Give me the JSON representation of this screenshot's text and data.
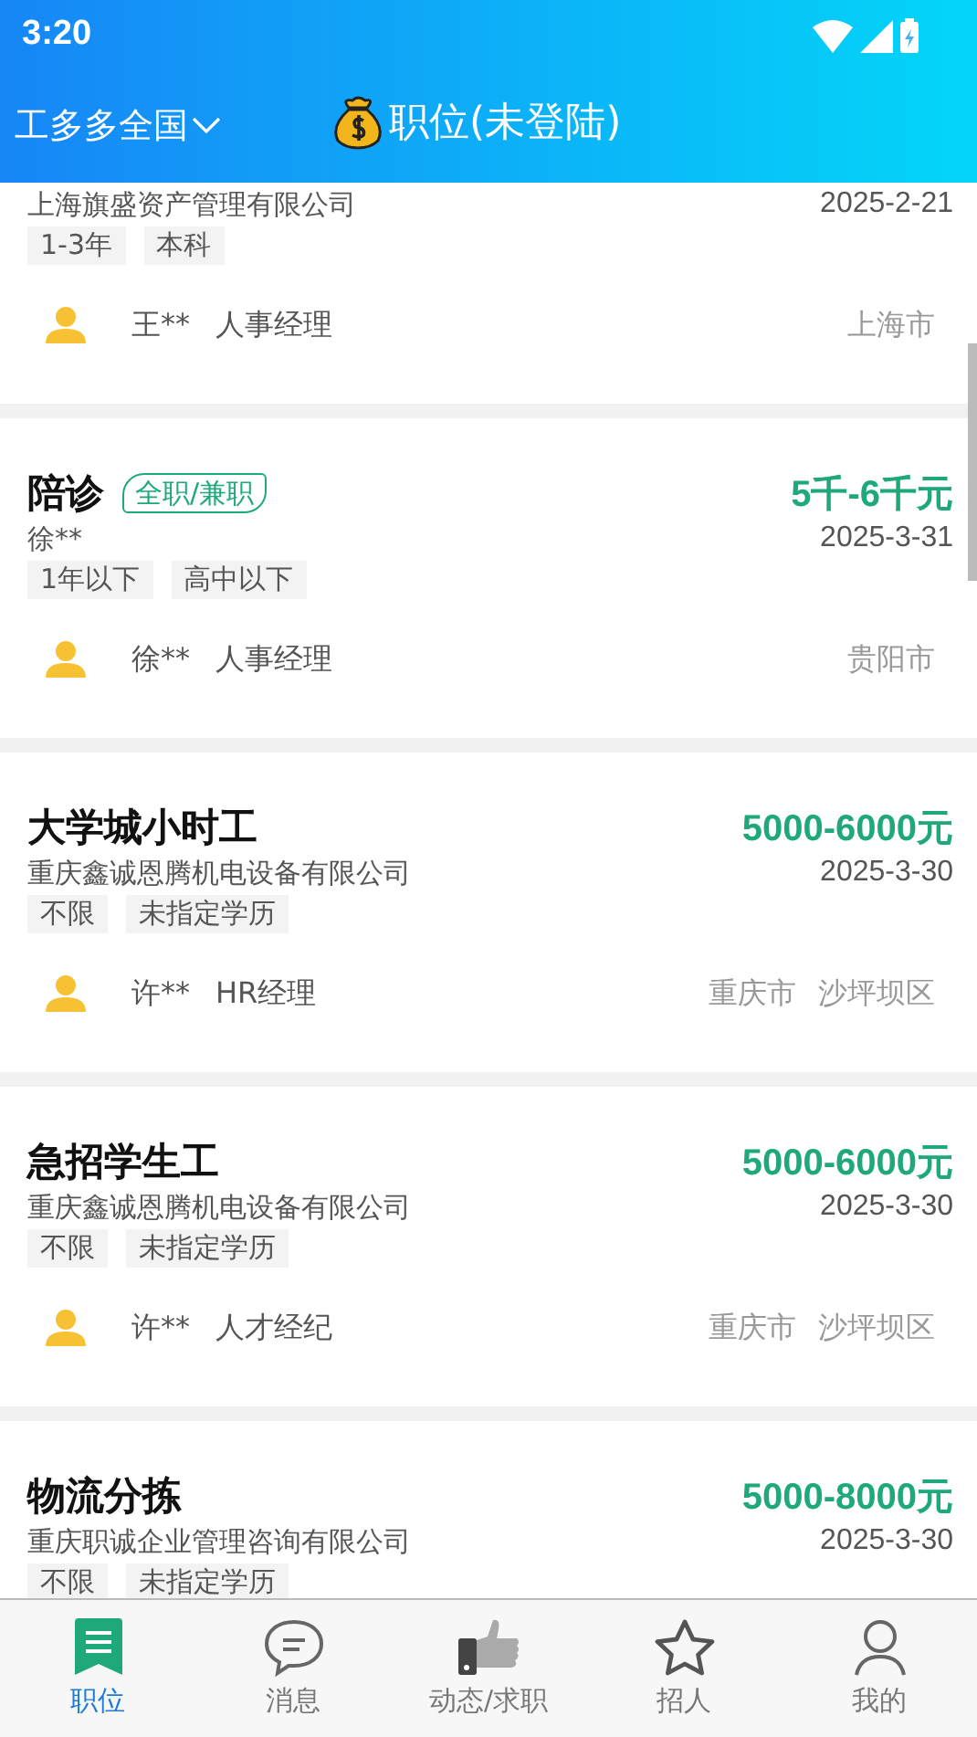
{
  "status_bar": {
    "time": "3:20"
  },
  "header": {
    "region": "工多多全国",
    "title": "职位(未登陆)"
  },
  "jobs": [
    {
      "company": "上海旗盛资产管理有限公司",
      "date": "2025-2-21",
      "tags": [
        "1-3年",
        "本科"
      ],
      "contact_name": "王**",
      "contact_role": "人事经理",
      "locations": [
        "上海市"
      ]
    },
    {
      "title": "陪诊",
      "job_type": "全职/兼职",
      "salary": "5千-6千元",
      "company": "徐**",
      "date": "2025-3-31",
      "tags": [
        "1年以下",
        "高中以下"
      ],
      "contact_name": "徐**",
      "contact_role": "人事经理",
      "locations": [
        "贵阳市"
      ]
    },
    {
      "title": "大学城小时工",
      "salary": "5000-6000元",
      "company": "重庆鑫诚恩腾机电设备有限公司",
      "date": "2025-3-30",
      "tags": [
        "不限",
        "未指定学历"
      ],
      "contact_name": "许**",
      "contact_role": "HR经理",
      "locations": [
        "重庆市",
        "沙坪坝区"
      ]
    },
    {
      "title": "急招学生工",
      "salary": "5000-6000元",
      "company": "重庆鑫诚恩腾机电设备有限公司",
      "date": "2025-3-30",
      "tags": [
        "不限",
        "未指定学历"
      ],
      "contact_name": "许**",
      "contact_role": "人才经纪",
      "locations": [
        "重庆市",
        "沙坪坝区"
      ]
    },
    {
      "title": "物流分拣",
      "salary": "5000-8000元",
      "company": "重庆职诚企业管理咨询有限公司",
      "date": "2025-3-30",
      "tags": [
        "不限",
        "未指定学历"
      ]
    }
  ],
  "tabs": [
    {
      "kind": "jobs",
      "label": "职位",
      "selected": true
    },
    {
      "kind": "messages",
      "label": "消息",
      "selected": false
    },
    {
      "kind": "feed",
      "label": "动态/求职",
      "selected": false
    },
    {
      "kind": "recruit",
      "label": "招人",
      "selected": false
    },
    {
      "kind": "profile",
      "label": "我的",
      "selected": false
    }
  ]
}
